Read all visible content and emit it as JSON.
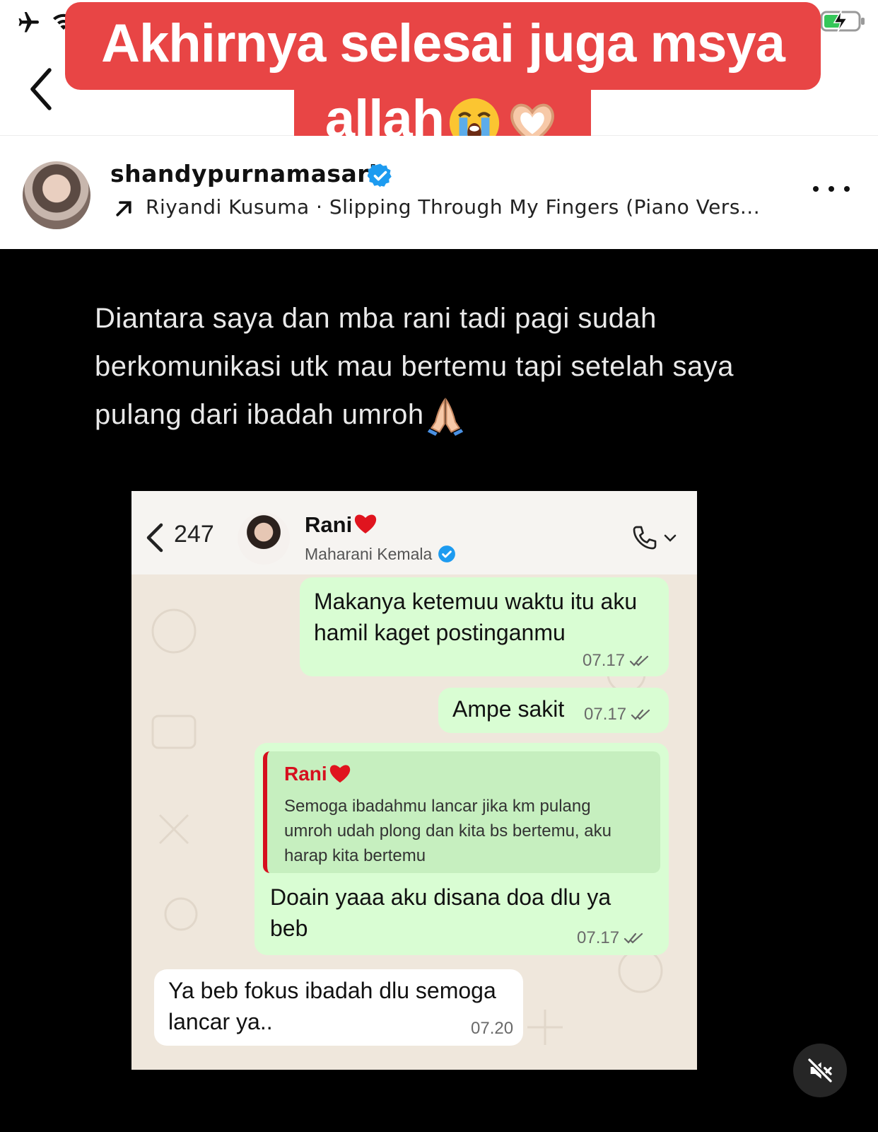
{
  "overlay_caption": {
    "line1": "Akhirnya selesai juga msya",
    "line2": "allah",
    "emojis": [
      "loudly-crying-face",
      "heart-hands"
    ]
  },
  "post": {
    "username": "shandypurnamasari",
    "verified": true,
    "music": "Riyandi Kusuma · Slipping Through My Fingers (Piano Vers..."
  },
  "video": {
    "caption_lines": [
      "Diantara saya dan mba rani tadi pagi sudah",
      "berkomunikasi utk mau bertemu tapi setelah saya",
      "pulang dari ibadah umroh"
    ],
    "caption_emoji": "folded-hands",
    "muted": true
  },
  "chat": {
    "back_count": "247",
    "contact_name": "Rani",
    "contact_subtitle": "Maharani Kemala",
    "messages": [
      {
        "direction": "out",
        "lines": [
          "Makanya ketemuu waktu itu aku",
          "hamil kaget postinganmu"
        ],
        "time": "07.17",
        "read": true
      },
      {
        "direction": "out",
        "lines": [
          "Ampe sakit"
        ],
        "time": "07.17",
        "read": true
      },
      {
        "direction": "out",
        "quote": {
          "name": "Rani",
          "lines": [
            "Semoga ibadahmu lancar jika km pulang",
            "umroh udah plong dan kita bs bertemu, aku",
            "harap kita bertemu"
          ]
        },
        "lines": [
          "Doain yaaa aku disana doa dlu ya",
          "beb"
        ],
        "time": "07.17",
        "read": true
      },
      {
        "direction": "in",
        "lines": [
          "Ya beb fokus ibadah dlu semoga",
          "lancar ya.."
        ],
        "time": "07.20"
      }
    ]
  },
  "colors": {
    "caption_bg": "#e84545",
    "bubble_out": "#d9fdd3",
    "bubble_in": "#ffffff",
    "quote_accent": "#d6101e",
    "verified": "#1d9bf0"
  }
}
